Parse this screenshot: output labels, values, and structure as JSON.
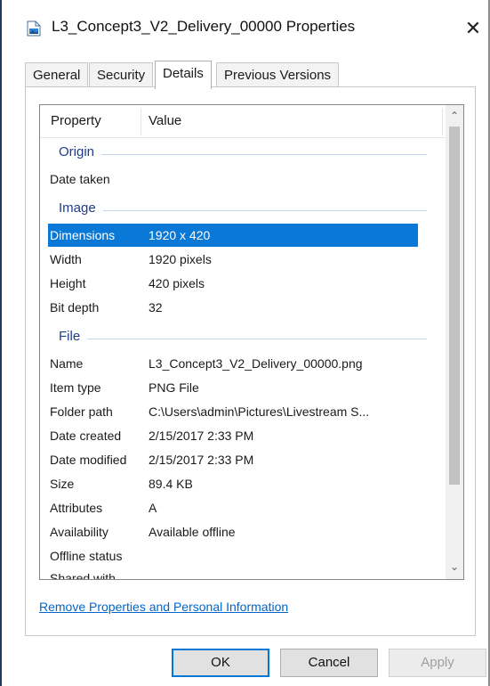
{
  "window": {
    "title": "L3_Concept3_V2_Delivery_00000 Properties",
    "close_glyph": "✕",
    "title_icon": "image-file-icon"
  },
  "tabs": [
    {
      "label": "General",
      "active": false
    },
    {
      "label": "Security",
      "active": false
    },
    {
      "label": "Details",
      "active": true
    },
    {
      "label": "Previous Versions",
      "active": false
    }
  ],
  "list": {
    "headers": {
      "property": "Property",
      "value": "Value"
    },
    "groups": {
      "origin": "Origin",
      "image": "Image",
      "file": "File"
    },
    "rows": [
      {
        "key": "Date taken",
        "value": ""
      },
      {
        "key": "Dimensions",
        "value": "1920 x 420",
        "selected": true
      },
      {
        "key": "Width",
        "value": "1920 pixels"
      },
      {
        "key": "Height",
        "value": "420 pixels"
      },
      {
        "key": "Bit depth",
        "value": "32"
      },
      {
        "key": "Name",
        "value": "L3_Concept3_V2_Delivery_00000.png"
      },
      {
        "key": "Item type",
        "value": "PNG File"
      },
      {
        "key": "Folder path",
        "value": "C:\\Users\\admin\\Pictures\\Livestream S..."
      },
      {
        "key": "Date created",
        "value": "2/15/2017 2:33 PM"
      },
      {
        "key": "Date modified",
        "value": "2/15/2017 2:33 PM"
      },
      {
        "key": "Size",
        "value": "89.4 KB"
      },
      {
        "key": "Attributes",
        "value": "A"
      },
      {
        "key": "Availability",
        "value": "Available offline"
      },
      {
        "key": "Offline status",
        "value": ""
      },
      {
        "key": "Shared with",
        "value": ""
      }
    ],
    "scroll": {
      "up_glyph": "⌃",
      "down_glyph": "⌄"
    }
  },
  "link": {
    "text": "Remove Properties and Personal Information"
  },
  "buttons": {
    "ok": "OK",
    "cancel": "Cancel",
    "apply": "Apply"
  },
  "colors": {
    "selection": "#0a78d7",
    "group_label": "#1e3c8c",
    "link": "#0066cc"
  }
}
